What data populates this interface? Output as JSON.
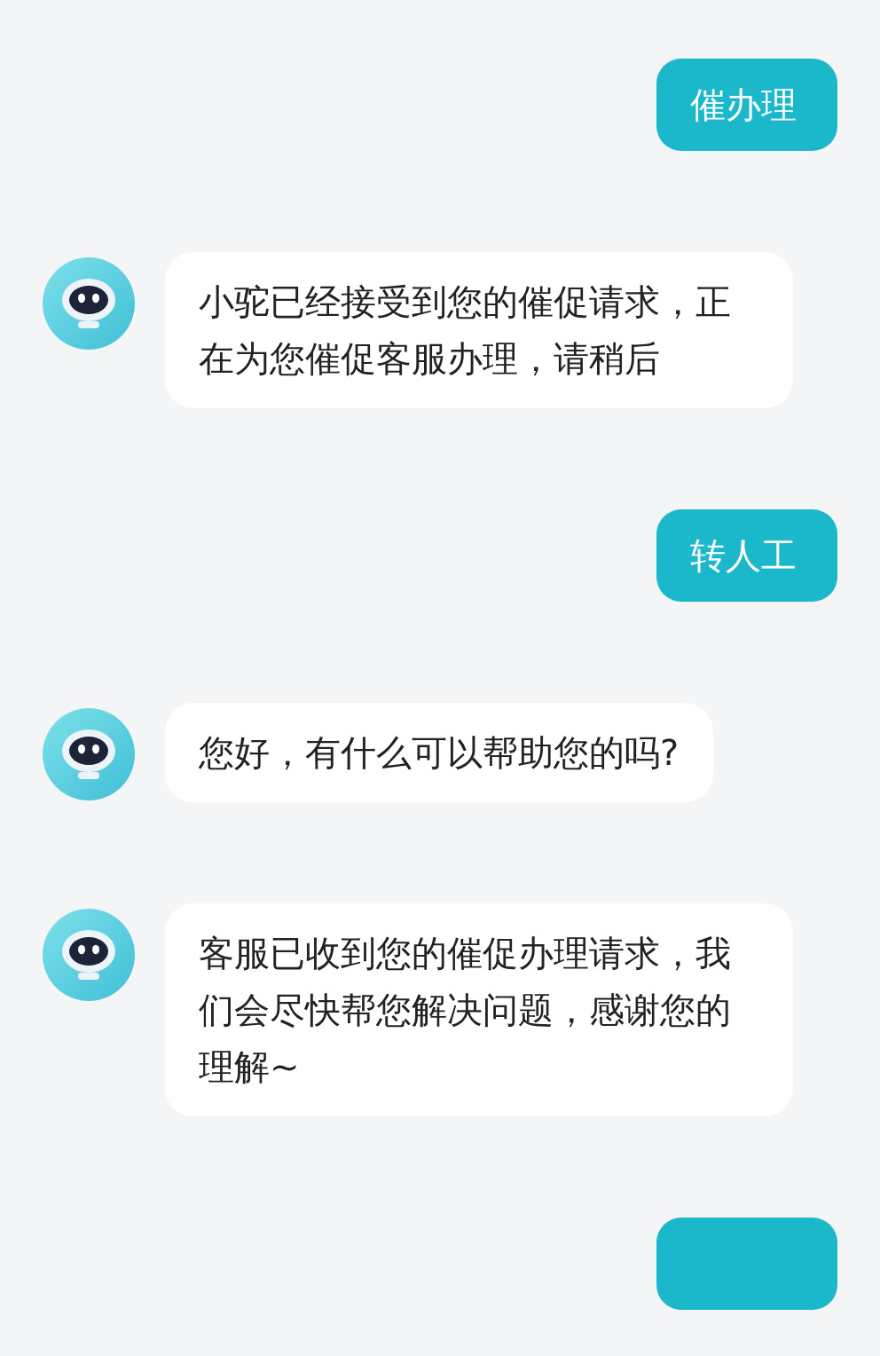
{
  "messages": [
    {
      "kind": "user",
      "text": "催办理"
    },
    {
      "kind": "bot",
      "text": "小驼已经接受到您的催促请求，正在为您催促客服办理，请稍后"
    },
    {
      "kind": "user",
      "text": "转人工"
    },
    {
      "kind": "bot",
      "text": "您好，有什么可以帮助您的吗?"
    },
    {
      "kind": "bot",
      "text": "客服已收到您的催促办理请求，我们会尽快帮您解决问题，感谢您的理解~"
    },
    {
      "kind": "user"
    }
  ]
}
